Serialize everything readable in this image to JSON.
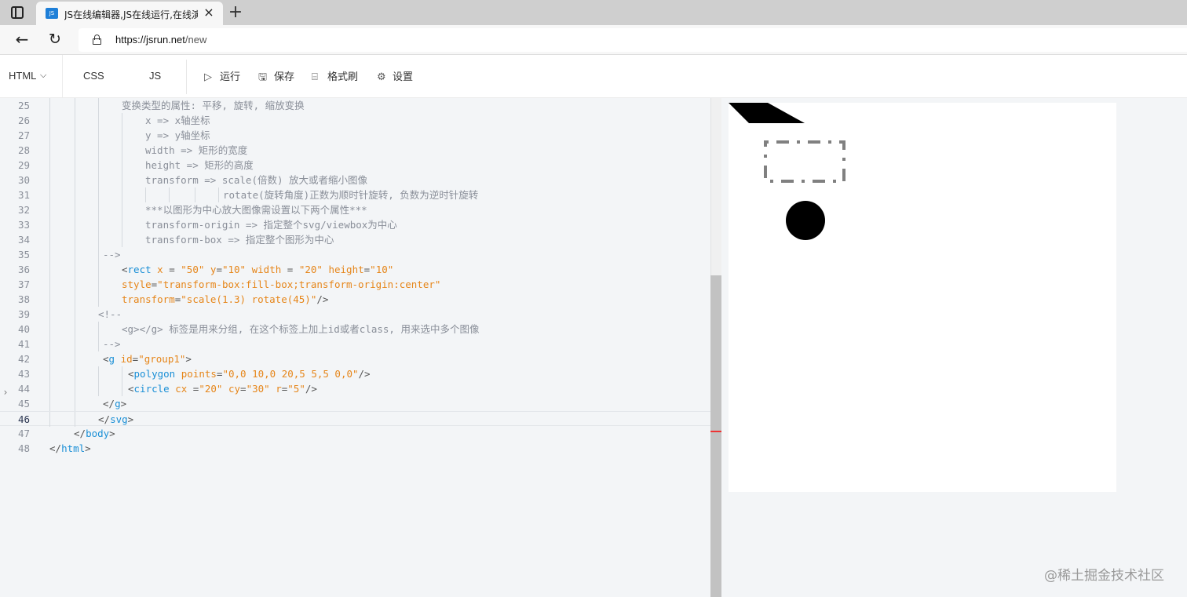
{
  "browser": {
    "tab_title": "JS在线编辑器,JS在线运行,在线演示",
    "favicon_text": "JS",
    "url_host": "https://jsrun.net",
    "url_path": "/new"
  },
  "toolbar": {
    "lang_label": "HTML",
    "tabs": [
      "CSS",
      "JS"
    ],
    "buttons": [
      {
        "label": "运行",
        "icon": "play-icon"
      },
      {
        "label": "保存",
        "icon": "save-icon"
      },
      {
        "label": "格式刷",
        "icon": "format-brush-icon"
      },
      {
        "label": "设置",
        "icon": "settings-icon"
      }
    ]
  },
  "editor": {
    "active_line": 46,
    "lines": [
      {
        "n": 25,
        "text": "变换类型的属性: 平移, 旋转, 缩放变换"
      },
      {
        "n": 26,
        "text": "x => x轴坐标"
      },
      {
        "n": 27,
        "text": "y => y轴坐标"
      },
      {
        "n": 28,
        "text": "width => 矩形的宽度"
      },
      {
        "n": 29,
        "text": "height => 矩形的高度"
      },
      {
        "n": 30,
        "text": "transform => scale(倍数) 放大或者缩小图像"
      },
      {
        "n": 31,
        "text": "rotate(旋转角度)正数为顺时针旋转, 负数为逆时针旋转"
      },
      {
        "n": 32,
        "text": "***以图形为中心放大图像需设置以下两个属性***"
      },
      {
        "n": 33,
        "text": "transform-origin => 指定整个svg/viewbox为中心"
      },
      {
        "n": 34,
        "text": "transform-box => 指定整个图形为中心"
      },
      {
        "n": 35,
        "text": "-->"
      },
      {
        "n": 36,
        "text": "<rect x = \"50\" y=\"10\" width = \"20\" height=\"10\""
      },
      {
        "n": 37,
        "text": "style=\"transform-box:fill-box;transform-origin:center\""
      },
      {
        "n": 38,
        "text": "transform=\"scale(1.3) rotate(45)\"/>"
      },
      {
        "n": 39,
        "text": "<!--"
      },
      {
        "n": 40,
        "text": "<g></g> 标签是用来分组, 在这个标签上加上id或者class, 用来选中多个图像"
      },
      {
        "n": 41,
        "text": "-->"
      },
      {
        "n": 42,
        "text": "<g id=\"group1\">"
      },
      {
        "n": 43,
        "text": "<polygon points=\"0,0 10,0 20,5 5,5 0,0\"/>"
      },
      {
        "n": 44,
        "text": "<circle cx =\"20\" cy=\"30\" r=\"5\"/>"
      },
      {
        "n": 45,
        "text": "</g>"
      },
      {
        "n": 46,
        "text": "</svg>"
      },
      {
        "n": 47,
        "text": "</body>"
      },
      {
        "n": 48,
        "text": "</html>"
      }
    ]
  },
  "preview": {
    "fill_color": "#000000",
    "dashed_stroke_color": "#808080"
  },
  "watermark": "@稀土掘金技术社区"
}
